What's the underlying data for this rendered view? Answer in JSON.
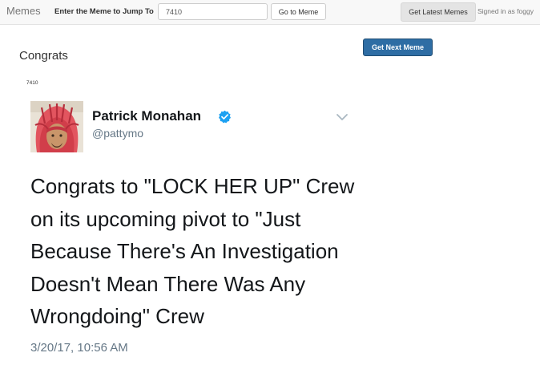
{
  "navbar": {
    "brand": "Memes",
    "jump_label": "Enter the Meme to Jump To",
    "jump_input_value": "7410",
    "go_button": "Go to Meme",
    "latest_button": "Get Latest Memes",
    "signed_in": "Signed in as foggy"
  },
  "page": {
    "title": "Congrats",
    "next_button": "Get Next Meme",
    "meme_id": "7410"
  },
  "tweet": {
    "author_name": "Patrick Monahan",
    "handle": "@pattymo",
    "text_lines": [
      "Congrats to \"LOCK HER UP\" Crew",
      "on its upcoming pivot to \"Just",
      "Because There's An Investigation",
      "Doesn't Mean There Was Any",
      "Wrongdoing\" Crew"
    ],
    "timestamp": "3/20/17, 10:56 AM",
    "verified_icon": "verified-check-icon",
    "menu_icon": "chevron-down-icon"
  },
  "colors": {
    "primary_button": "#2e6da4",
    "verified_blue": "#1da1f2",
    "muted_text": "#657786"
  }
}
